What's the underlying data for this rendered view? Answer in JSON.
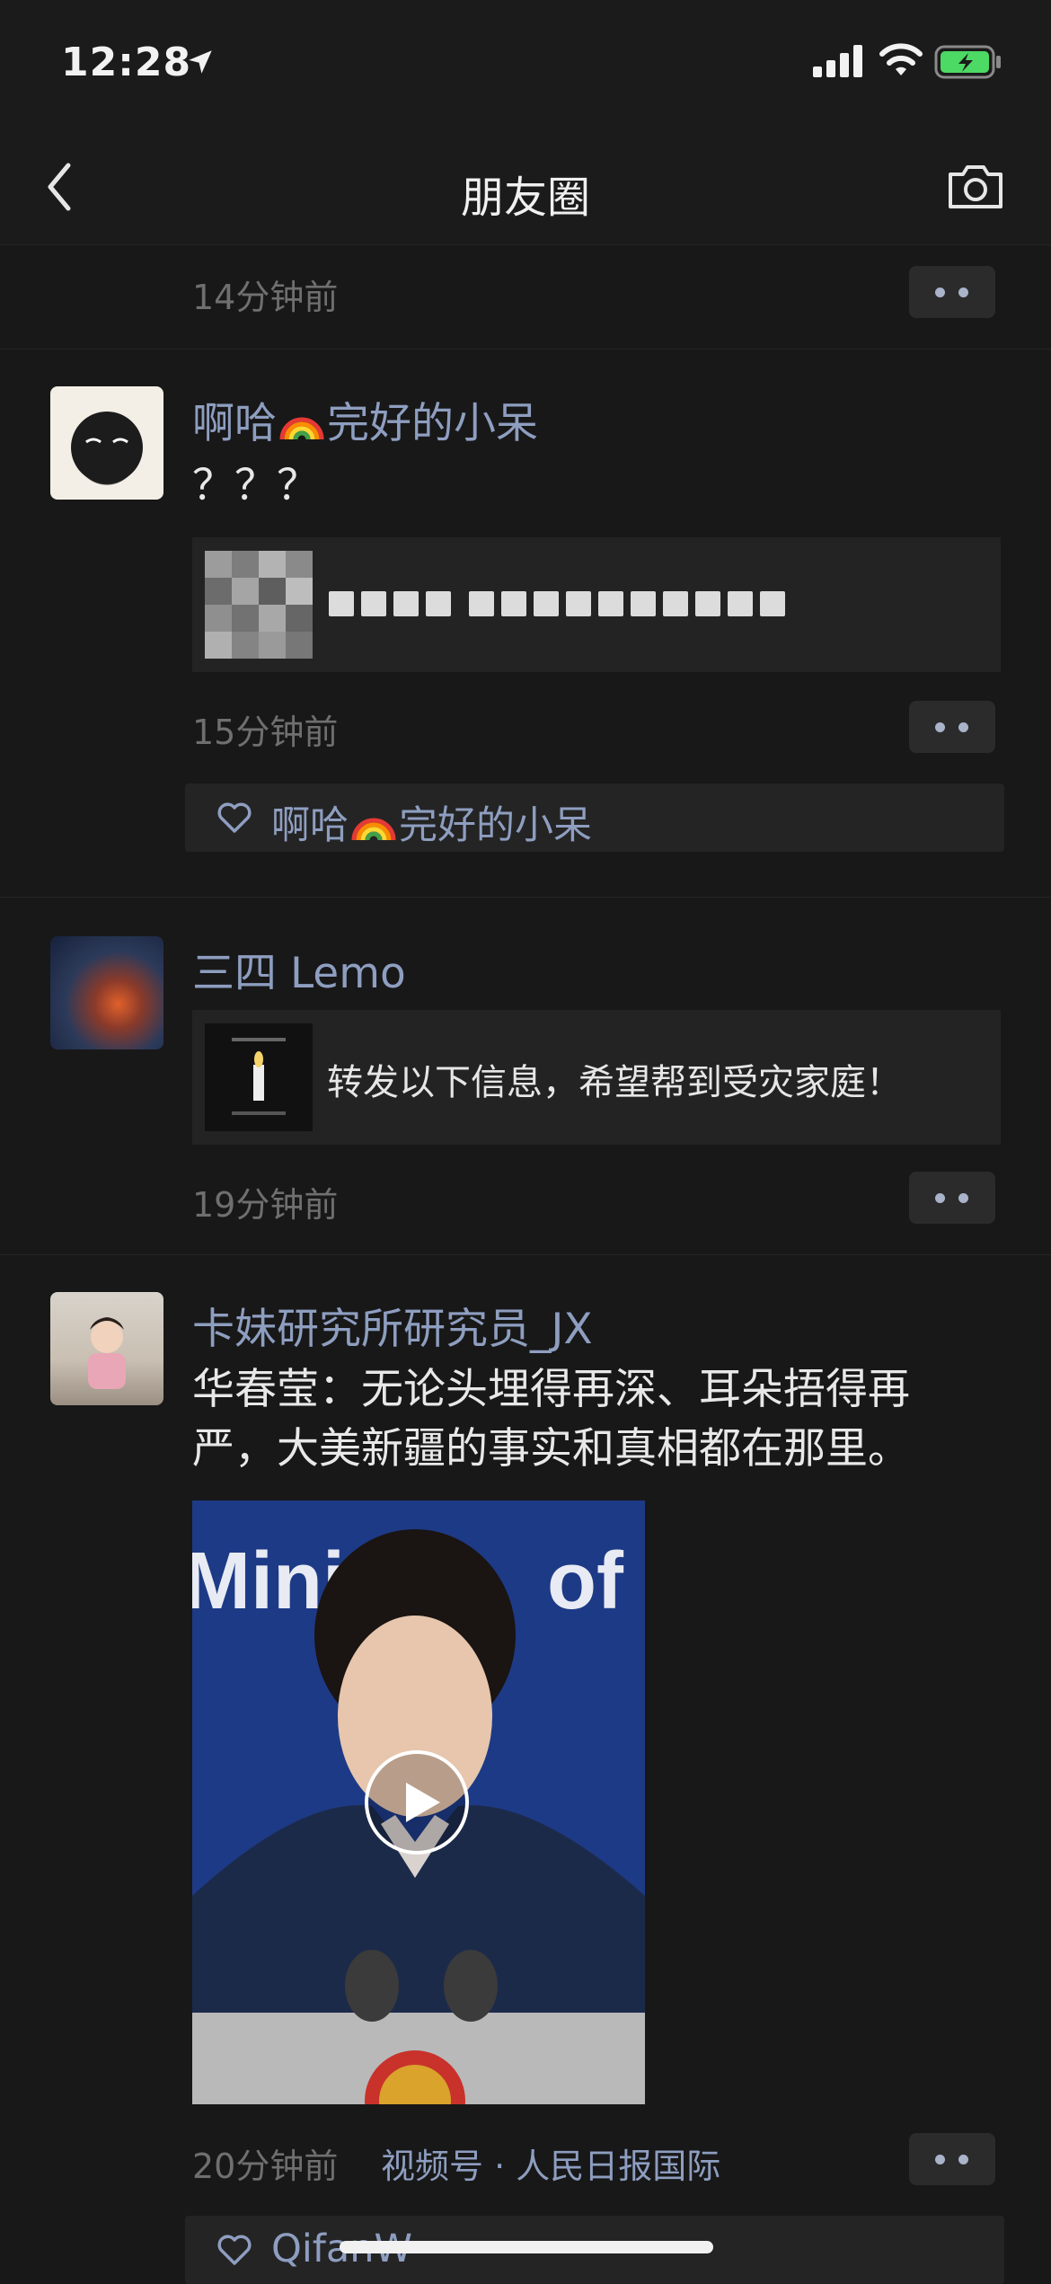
{
  "status_bar": {
    "time": "12:28"
  },
  "nav": {
    "title": "朋友圈"
  },
  "posts": [
    {
      "timestamp": "14分钟前"
    },
    {
      "name": "啊哈🌈完好的小呆",
      "name_a": "啊哈",
      "name_b": "完好的小呆",
      "text": "？？？",
      "timestamp": "15分钟前",
      "likes": {
        "name_a": "啊哈",
        "name_b": "完好的小呆"
      }
    },
    {
      "name": "三四 Lemo",
      "share_text": "转发以下信息，希望帮到受灾家庭！",
      "timestamp": "19分钟前"
    },
    {
      "name": "卡妹研究所研究员_JX",
      "text_line1": "华春莹：无论头埋得再深、耳朵捂得再",
      "text_line2": "严，大美新疆的事实和真相都在那里。",
      "timestamp": "20分钟前",
      "channel": "视频号 · 人民日报国际",
      "likes_name": "QifanW"
    }
  ],
  "icons": [
    "location-arrow-icon",
    "signal-icon",
    "wifi-icon",
    "battery-icon",
    "back-chevron-icon",
    "camera-icon",
    "more-dots-icon",
    "heart-icon",
    "rainbow-icon",
    "play-icon"
  ]
}
